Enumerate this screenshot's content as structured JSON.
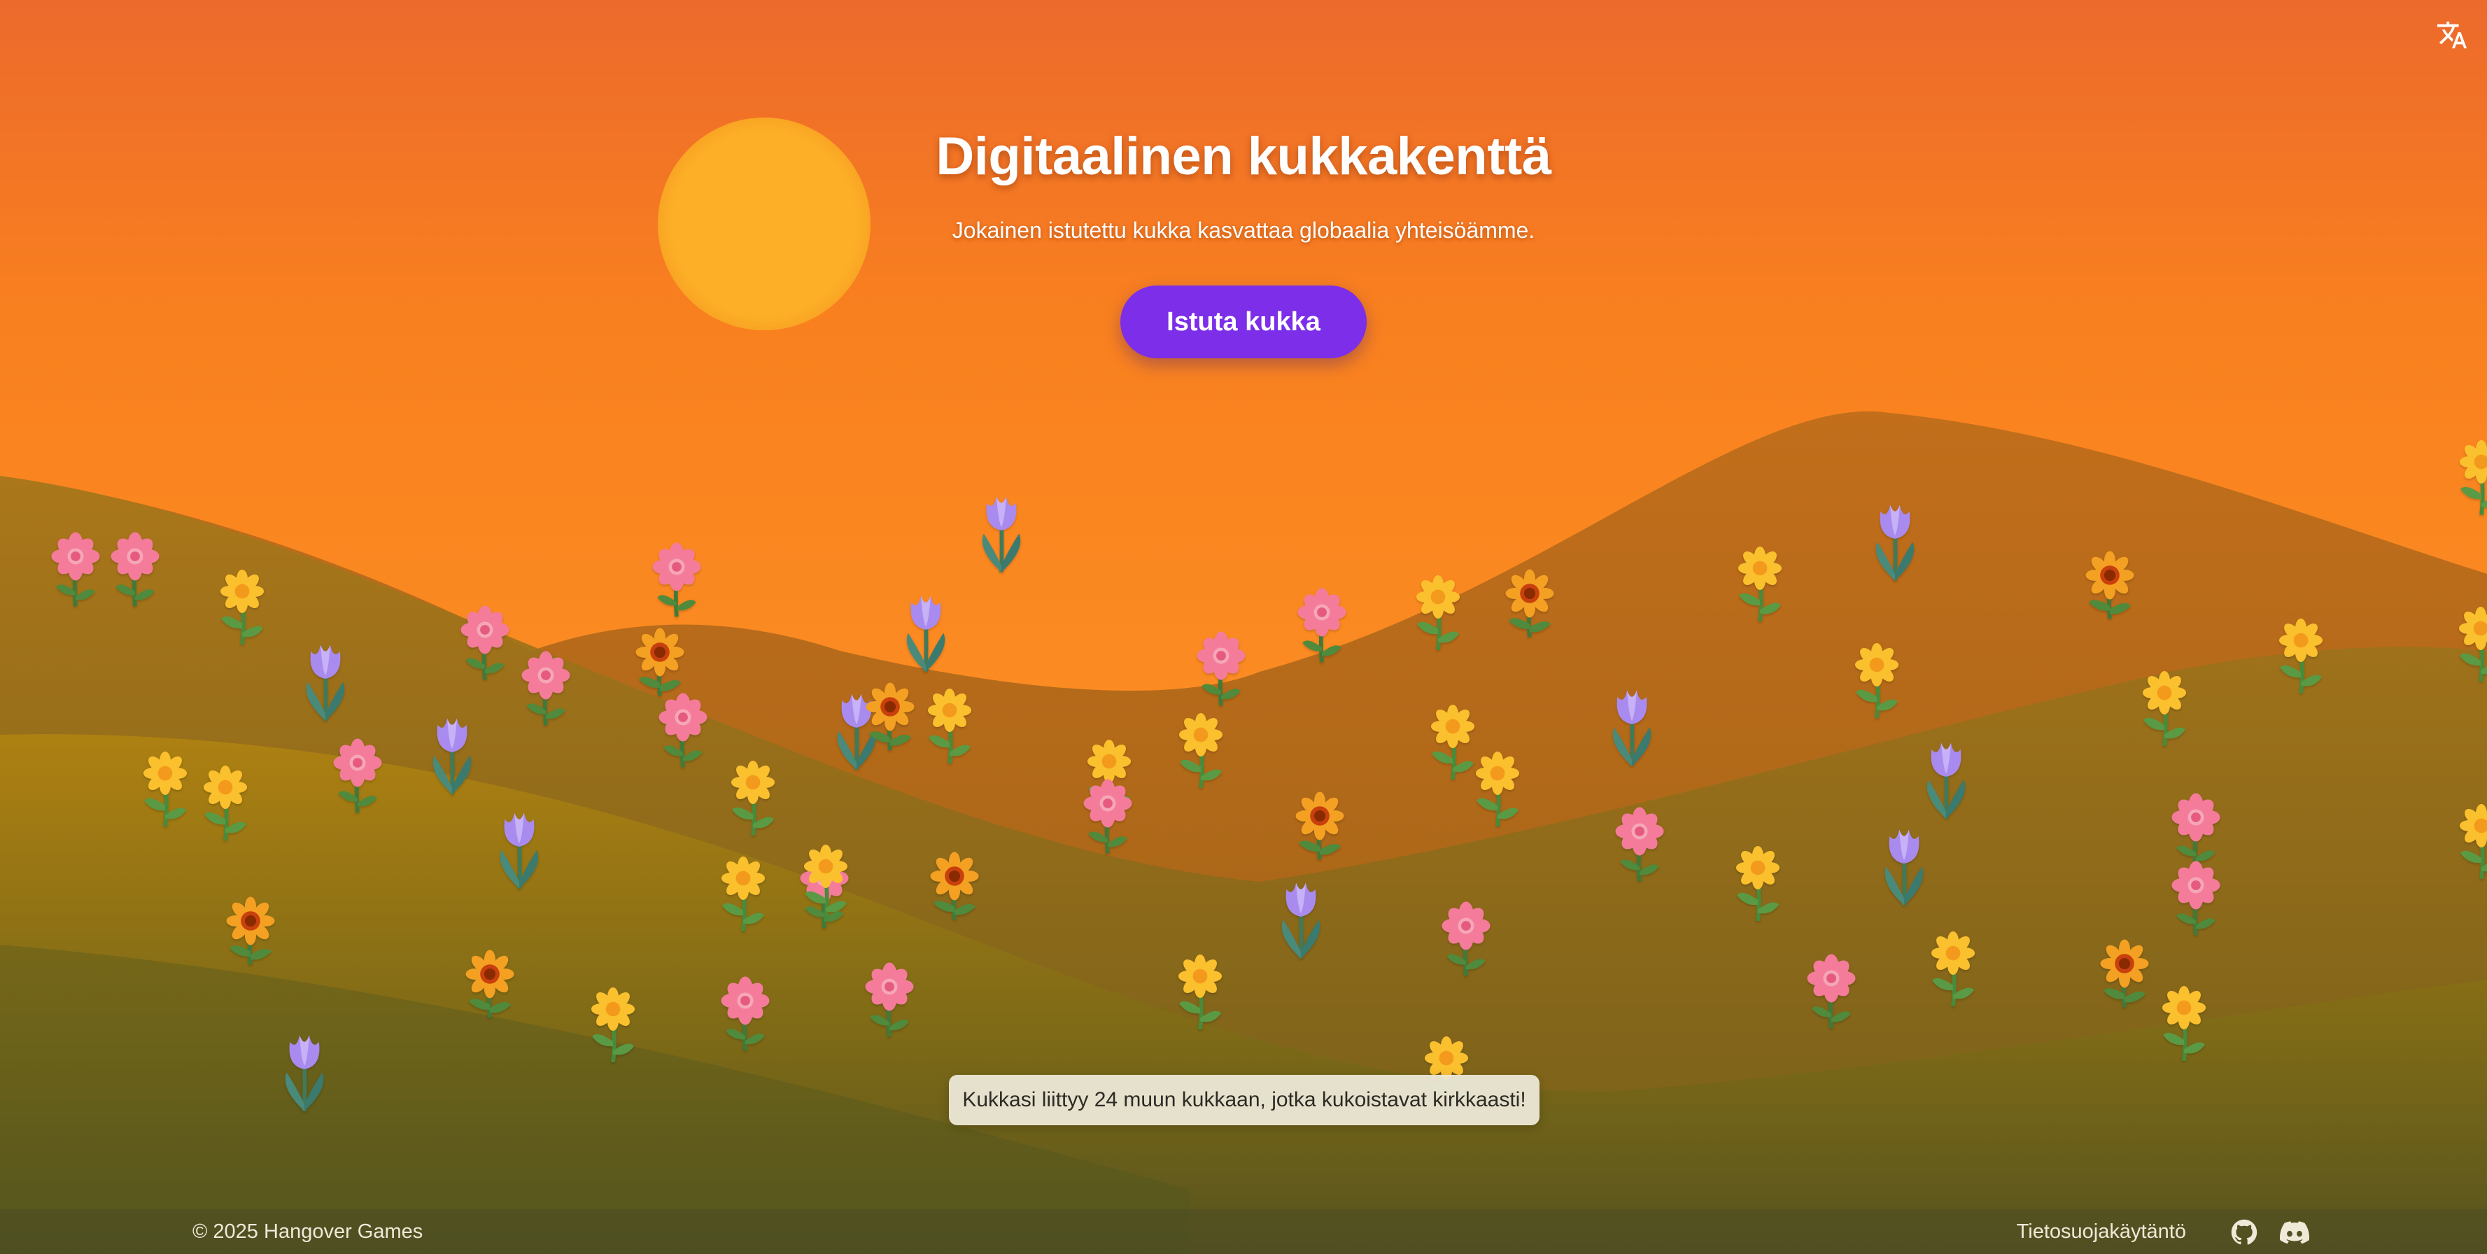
{
  "header": {
    "title": "Digitaalinen kukkakenttä",
    "subtitle": "Jokainen istutettu kukka kasvattaa globaalia yhteisöämme.",
    "plant_button": "Istuta kukka"
  },
  "toast": {
    "message": "Kukkasi liittyy 24 muun kukkaan, jotka kukoistavat kirkkaasti!"
  },
  "footer": {
    "copyright": "© 2025 Hangover Games",
    "privacy_link": "Tietosuojakäytäntö"
  },
  "icons": {
    "language": "translate-icon",
    "github": "github-icon",
    "discord": "discord-icon"
  },
  "colors": {
    "sky_top": "#ec6a2c",
    "sky_mid": "#fb8a22",
    "sun": "#fdb027",
    "button": "#7c2ee8",
    "hill": "#8a6a1a"
  },
  "flowers": {
    "count_visible": 76,
    "types": [
      "daisy-pink",
      "sunflower-yellow",
      "sunflower-orange",
      "tulip-purple"
    ]
  }
}
